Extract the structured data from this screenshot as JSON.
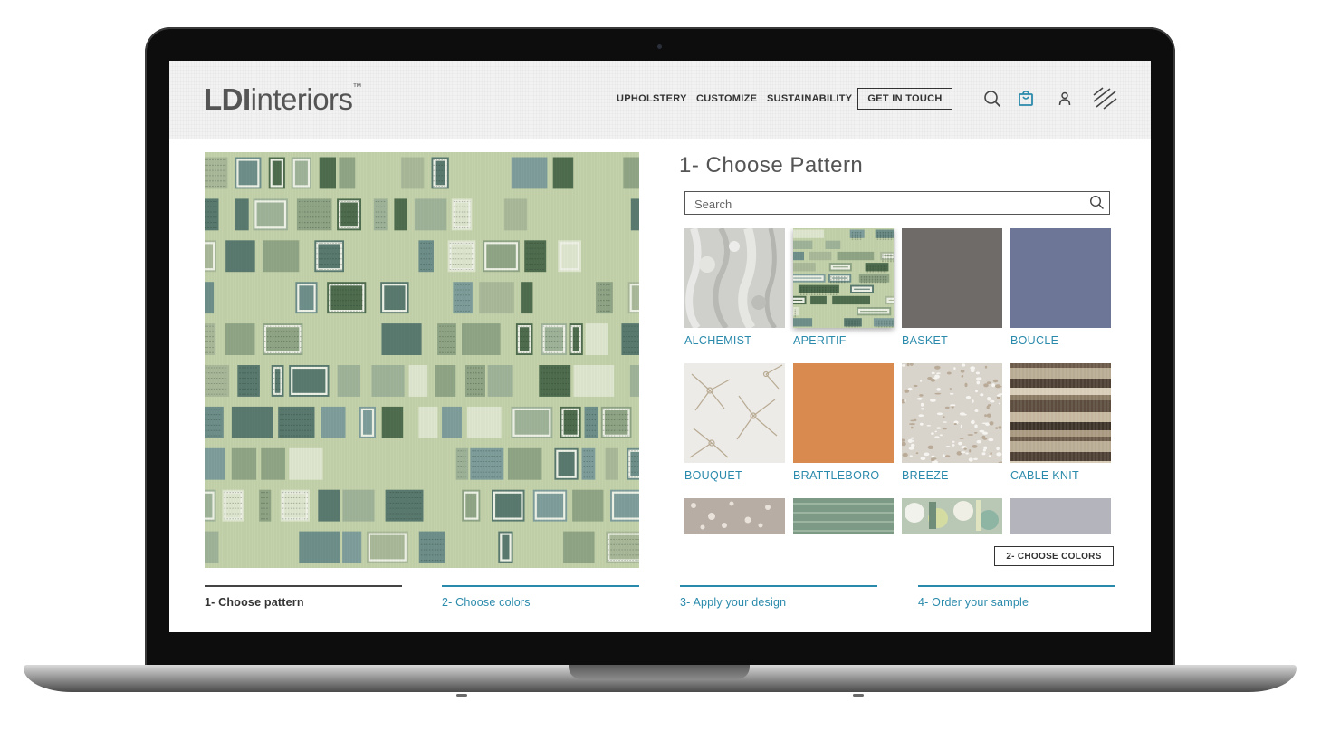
{
  "brand": {
    "logo_bold": "LDI",
    "logo_rest": "interiors",
    "logo_tm": "™"
  },
  "nav": {
    "upholstery": "UPHOLSTERY",
    "customize": "CUSTOMIZE",
    "sustainability": "SUSTAINABILITY",
    "get_in_touch": "GET IN TOUCH"
  },
  "icons": {
    "search": "search-icon",
    "cart": "shopping-bag-icon",
    "account": "user-icon",
    "menu": "diagonal-lines-menu-icon"
  },
  "pattern_panel": {
    "title": "1- Choose Pattern",
    "search_placeholder": "Search",
    "patterns": [
      {
        "name": "ALCHEMIST",
        "selected": false
      },
      {
        "name": "APERITIF",
        "selected": true
      },
      {
        "name": "BASKET",
        "selected": false
      },
      {
        "name": "BOUCLE",
        "selected": false
      },
      {
        "name": "BOUQUET",
        "selected": false
      },
      {
        "name": "BRATTLEBORO",
        "selected": false
      },
      {
        "name": "BREEZE",
        "selected": false
      },
      {
        "name": "CABLE KNIT",
        "selected": false
      }
    ],
    "next_button": "2- CHOOSE COLORS"
  },
  "steps": [
    {
      "label": "1- Choose pattern",
      "active": true
    },
    {
      "label": "2- Choose colors",
      "active": false
    },
    {
      "label": "3- Apply your design",
      "active": false
    },
    {
      "label": "4- Order your sample",
      "active": false
    }
  ],
  "colors": {
    "accent": "#2a8aab",
    "text_dark": "#333333",
    "fabric_green": "#c3d2aa"
  }
}
